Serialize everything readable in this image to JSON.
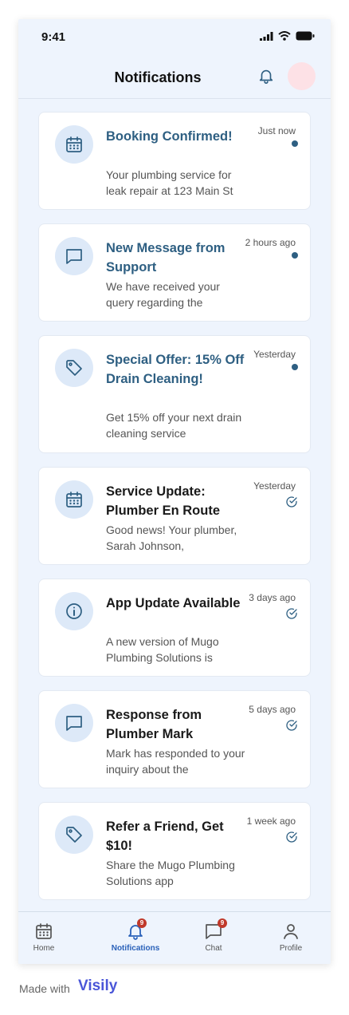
{
  "status_bar": {
    "time": "9:41"
  },
  "header": {
    "title": "Notifications"
  },
  "notifications": [
    {
      "title": "Booking Confirmed!",
      "time": "Just now",
      "body": "Your plumbing service for leak repair at 123 Main St",
      "icon": "calendar-icon",
      "state": "unread"
    },
    {
      "title": "New Message from Support",
      "time": "2 hours ago",
      "body": "We have received your query regarding the",
      "icon": "message-icon",
      "state": "unread"
    },
    {
      "title": "Special Offer: 15% Off Drain Cleaning!",
      "time": "Yesterday",
      "body": "Get 15% off your next drain cleaning service",
      "icon": "tag-icon",
      "state": "unread"
    },
    {
      "title": "Service Update: Plumber En Route",
      "time": "Yesterday",
      "body": "Good news! Your plumber, Sarah Johnson,",
      "icon": "calendar-icon",
      "state": "read"
    },
    {
      "title": "App Update Available",
      "time": "3 days ago",
      "body": "A new version of Mugo Plumbing Solutions is",
      "icon": "info-icon",
      "state": "read"
    },
    {
      "title": "Response from Plumber Mark",
      "time": "5 days ago",
      "body": "Mark has responded to your inquiry about the",
      "icon": "message-icon",
      "state": "read"
    },
    {
      "title": "Refer a Friend, Get $10!",
      "time": "1 week ago",
      "body": "Share the Mugo Plumbing Solutions app",
      "icon": "tag-icon",
      "state": "read"
    }
  ],
  "bottom_nav": {
    "home": "Home",
    "notifications": "Notifications",
    "notifications_badge": "9",
    "chat": "Chat",
    "chat_badge": "9",
    "profile": "Profile"
  },
  "footer": {
    "made_with": "Made with",
    "brand": "Visily"
  },
  "colors": {
    "accent": "#2a61b9",
    "unread_title": "#2e5f82",
    "badge": "#c0392b",
    "background": "#eef4fd"
  }
}
